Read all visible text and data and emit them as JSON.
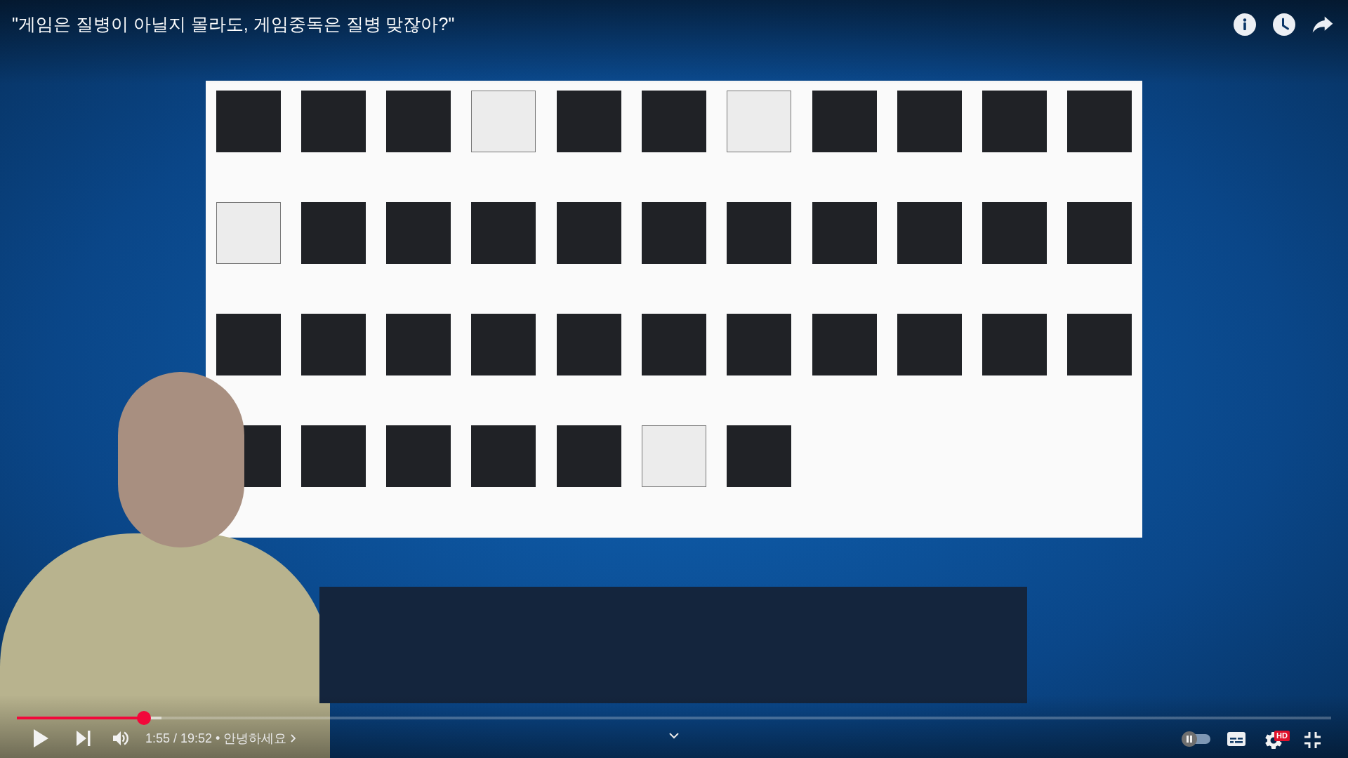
{
  "player": {
    "title": "\"게임은 질병이 아닐지 몰라도, 게임중독은 질병 맞잖아?\"",
    "time": "1:55 / 19:52",
    "chapter": "• 안녕하세요"
  },
  "progress": {
    "level": 0.0965
  },
  "buffer": {
    "level": 0.11
  },
  "controls": {
    "playing": false,
    "muted": false,
    "autoplay": {
      "on": false
    },
    "subtitles": {
      "on": false
    },
    "quality_badge": "HD",
    "fullscreen": {
      "on": true
    }
  }
}
